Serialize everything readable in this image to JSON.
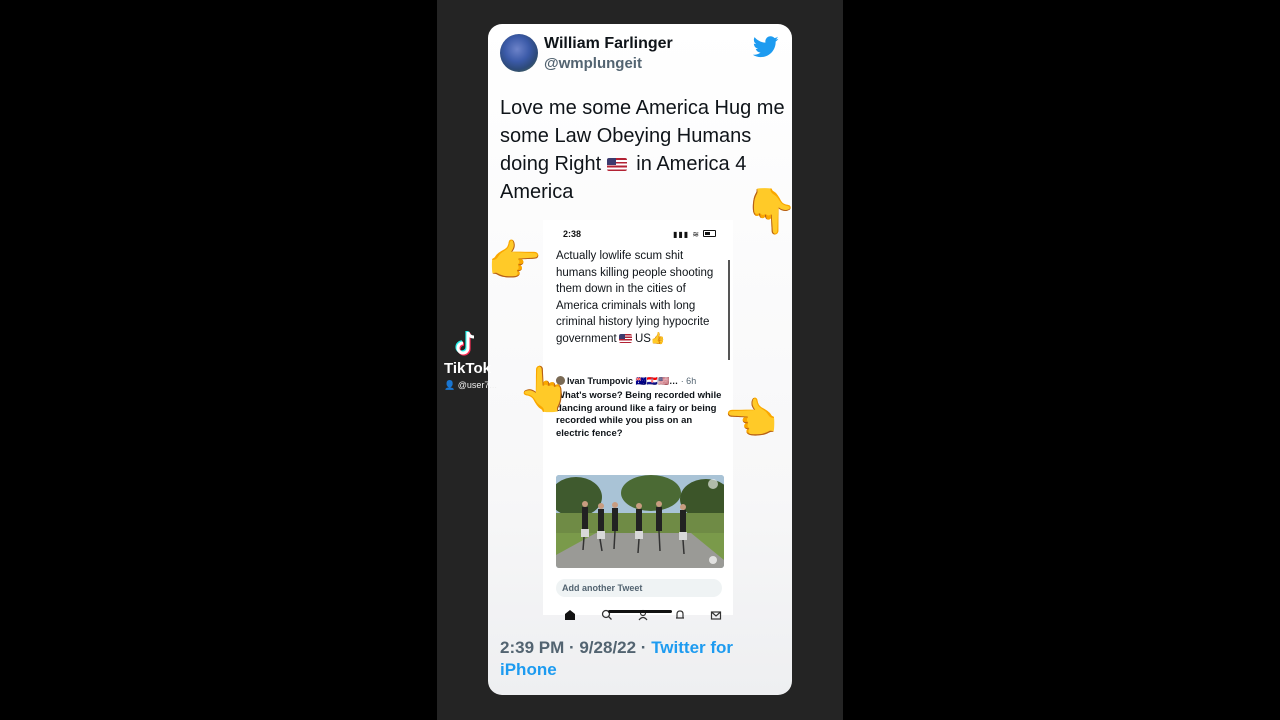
{
  "tweet": {
    "name": "William Farlinger",
    "handle": "@wmplungeit",
    "text_before_flag": "Love me some America Hug me some Law Obeying Humans doing Right",
    "text_after_flag": " in America 4 America",
    "footer_time": "2:39 PM · 9/28/22 · ",
    "footer_client": "Twitter for iPhone"
  },
  "screenshot": {
    "status_time": "2:38",
    "reply_text": "Actually lowlife scum shit humans killing people shooting them down in the cities of America criminals with long criminal history lying hypocrite government",
    "reply_end": "US",
    "quote_author": "Ivan Trumpovic",
    "quote_time": "· 6h",
    "quote_text": "What's worse? Being recorded while dancing around like a fairy or being recorded while you piss on an electric fence?",
    "add_tweet": "Add another Tweet"
  },
  "overlay": {
    "tiktok_name": "TikTok",
    "tiktok_user": "@user7..."
  },
  "icons": [
    "twitter-bird-icon",
    "home-icon",
    "search-icon",
    "spaces-icon",
    "bell-icon",
    "mail-icon",
    "tiktok-logo-icon"
  ],
  "colors": {
    "twitter_blue": "#1d9bf0",
    "muted_gray": "#536471"
  }
}
